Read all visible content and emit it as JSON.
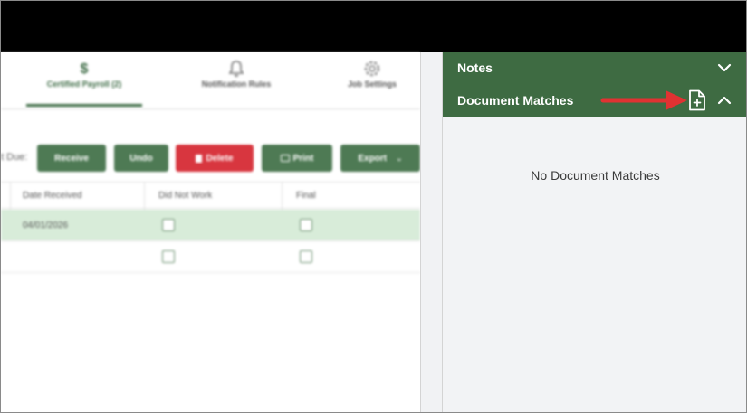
{
  "tabs": [
    {
      "label": "Certified Payroll (2)",
      "icon": "dollar-icon",
      "active": true
    },
    {
      "label": "Notification Rules",
      "icon": "bell-icon",
      "active": false
    },
    {
      "label": "Job Settings",
      "icon": "gear-icon",
      "active": false
    }
  ],
  "toolbar": {
    "due_label": "t Due:",
    "buttons": {
      "receive": "Receive",
      "undo": "Undo",
      "delete": "Delete",
      "print": "Print",
      "export": "Export"
    }
  },
  "grid": {
    "headers": [
      "Date Received",
      "Did Not Work",
      "Final"
    ],
    "rows": [
      {
        "date_received": "04/01/2026",
        "did_not_work": false,
        "final": false,
        "selected": true
      },
      {
        "date_received": "",
        "did_not_work": false,
        "final": false,
        "selected": false
      }
    ]
  },
  "panel": {
    "notes_title": "Notes",
    "document_matches_title": "Document Matches",
    "empty_message": "No Document Matches"
  },
  "colors": {
    "panel_header": "#3e6b42",
    "primary_button": "#4e7a54",
    "delete_button": "#d8363f",
    "annotation_arrow": "#e03232",
    "selected_row": "#d8ecd9"
  }
}
